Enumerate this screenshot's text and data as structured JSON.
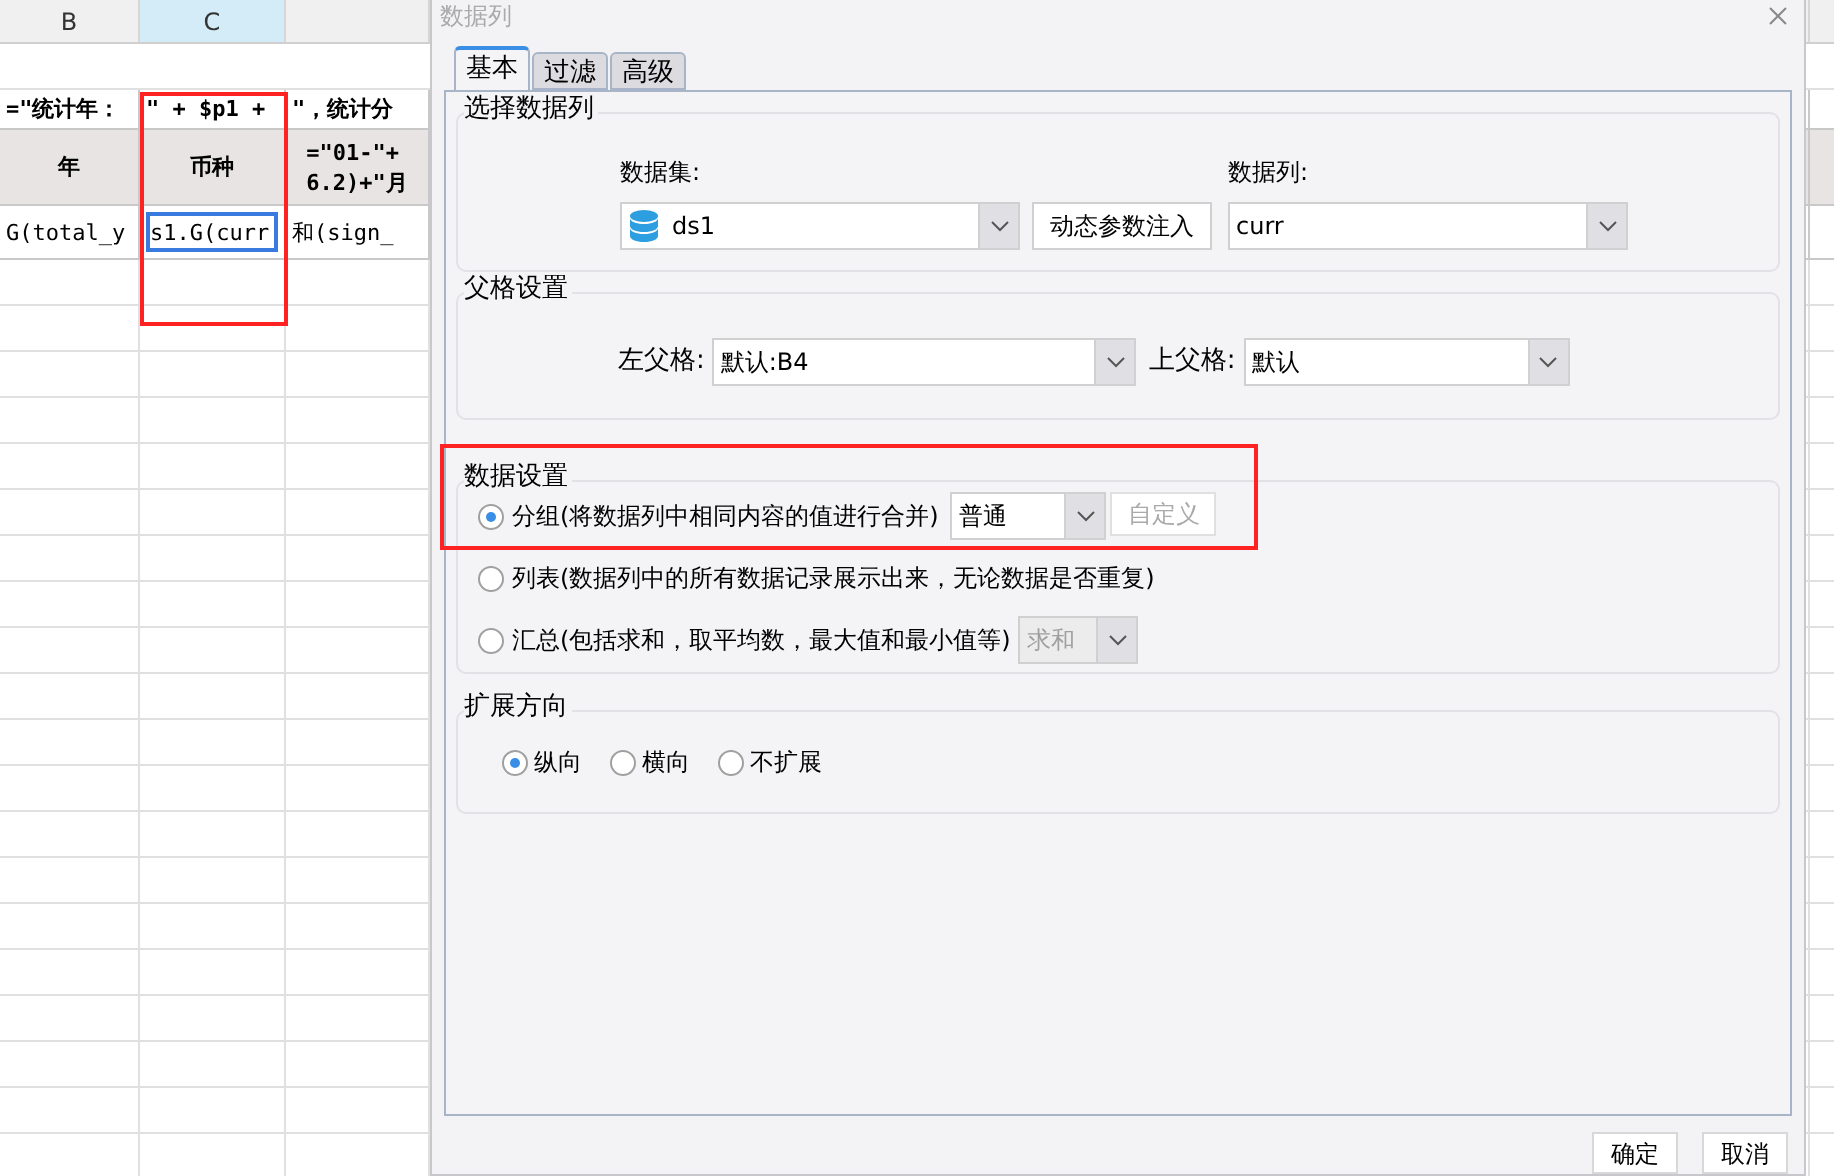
{
  "sheet": {
    "columns": [
      {
        "label": "B",
        "selected": false
      },
      {
        "label": "C",
        "selected": true
      }
    ],
    "rows": [
      {
        "kind": "formula",
        "cells": [
          {
            "text": "=\"统计年：",
            "selected": false
          },
          {
            "text": "\" + $p1 +",
            "selected": false
          },
          {
            "text": "\"，统计分",
            "selected": false
          }
        ]
      },
      {
        "kind": "header",
        "cells": [
          {
            "text": "年",
            "selected": false
          },
          {
            "text": "币种",
            "selected": false
          },
          {
            "text": "=\"01-\"+\n6.2)+\"月",
            "selected": false
          }
        ]
      },
      {
        "kind": "data",
        "cells": [
          {
            "text": "G(total_y",
            "selected": false
          },
          {
            "text": "s1.G(curr",
            "selected": true
          },
          {
            "text": "和(sign_",
            "selected": false
          }
        ]
      }
    ]
  },
  "dialog": {
    "title": "数据列",
    "tabs": [
      {
        "label": "基本",
        "selected": true
      },
      {
        "label": "过滤",
        "selected": false
      },
      {
        "label": "高级",
        "selected": false
      }
    ],
    "dataset_section": {
      "title": "选择数据列",
      "dataset_label": "数据集:",
      "dataset_value": "ds1",
      "inject_button": "动态参数注入",
      "column_label": "数据列:",
      "column_value": "curr"
    },
    "parent_section": {
      "title": "父格设置",
      "left_label": "左父格:",
      "left_value": "默认:B4",
      "top_label": "上父格:",
      "top_value": "默认"
    },
    "data_section": {
      "title": "数据设置",
      "options": [
        {
          "kind": "group",
          "label": "分组(将数据列中相同内容的值进行合并)",
          "selected": true,
          "select_value": "普通",
          "button": "自定义"
        },
        {
          "kind": "list",
          "label": "列表(数据列中的所有数据记录展示出来，无论数据是否重复)",
          "selected": false
        },
        {
          "kind": "summary",
          "label": "汇总(包括求和，取平均数，最大值和最小值等)",
          "selected": false,
          "select_value": "求和"
        }
      ]
    },
    "expand_section": {
      "title": "扩展方向",
      "options": [
        {
          "label": "纵向",
          "selected": true
        },
        {
          "label": "横向",
          "selected": false
        },
        {
          "label": "不扩展",
          "selected": false
        }
      ]
    },
    "buttons": [
      "确定",
      "取消"
    ]
  }
}
